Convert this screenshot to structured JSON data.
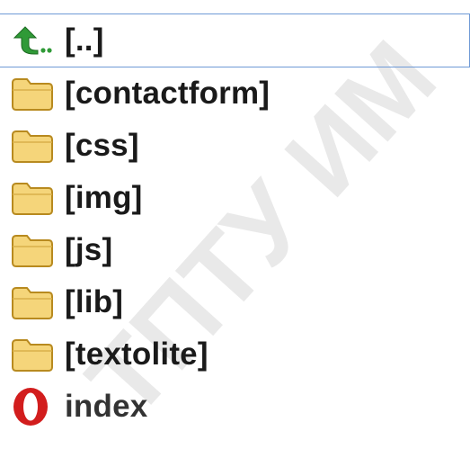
{
  "watermark": {
    "text": "ТПТУ ИМ"
  },
  "entries": [
    {
      "label": "[..]",
      "icon": "up-arrow-icon",
      "kind": "parent"
    },
    {
      "label": "[contactform]",
      "icon": "folder-icon",
      "kind": "folder"
    },
    {
      "label": "[css]",
      "icon": "folder-icon",
      "kind": "folder"
    },
    {
      "label": "[img]",
      "icon": "folder-icon",
      "kind": "folder"
    },
    {
      "label": "[js]",
      "icon": "folder-icon",
      "kind": "folder"
    },
    {
      "label": "[lib]",
      "icon": "folder-icon",
      "kind": "folder"
    },
    {
      "label": "[textolite]",
      "icon": "folder-icon",
      "kind": "folder"
    },
    {
      "label": "index",
      "icon": "opera-icon",
      "kind": "file"
    }
  ],
  "colors": {
    "selection_border": "#6f9ad6",
    "folder_fill": "#f5d57a",
    "folder_edge": "#b88a1f",
    "arrow_green": "#2f9a37",
    "opera_red": "#d21d1d"
  }
}
